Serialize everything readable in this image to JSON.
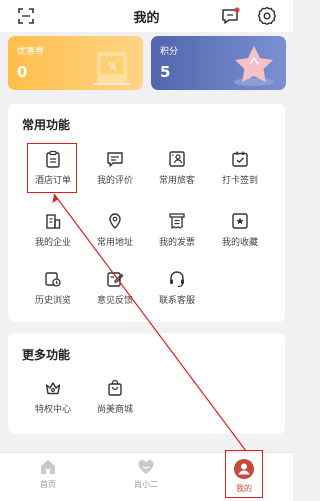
{
  "header": {
    "title": "我的"
  },
  "cards": {
    "coupon": {
      "label": "优惠券",
      "value": "0"
    },
    "points": {
      "label": "积分",
      "value": "5"
    }
  },
  "common": {
    "title": "常用功能",
    "items": [
      {
        "label": "酒店订单",
        "icon": "clipboard-icon"
      },
      {
        "label": "我的评价",
        "icon": "comment-icon"
      },
      {
        "label": "常用旅客",
        "icon": "contact-card-icon"
      },
      {
        "label": "打卡签到",
        "icon": "calendar-check-icon"
      },
      {
        "label": "我的企业",
        "icon": "building-icon"
      },
      {
        "label": "常用地址",
        "icon": "location-pin-icon"
      },
      {
        "label": "我的发票",
        "icon": "receipt-icon"
      },
      {
        "label": "我的收藏",
        "icon": "star-box-icon"
      },
      {
        "label": "历史浏览",
        "icon": "history-icon"
      },
      {
        "label": "意见反馈",
        "icon": "feedback-icon"
      },
      {
        "label": "联系客服",
        "icon": "headset-icon"
      }
    ]
  },
  "more": {
    "title": "更多功能",
    "items": [
      {
        "label": "特权中心",
        "icon": "crown-icon"
      },
      {
        "label": "尚美商城",
        "icon": "shopping-bag-icon"
      }
    ]
  },
  "tabs": [
    {
      "label": "首页",
      "icon": "home-icon"
    },
    {
      "label": "尚小二",
      "icon": "heart-icon"
    },
    {
      "label": "我的",
      "icon": "profile-icon",
      "active": true
    }
  ],
  "colors": {
    "accent": "#c74a3b",
    "annotation": "#e02020",
    "coupon": "#ffbe4a",
    "points": "#5165ad"
  }
}
